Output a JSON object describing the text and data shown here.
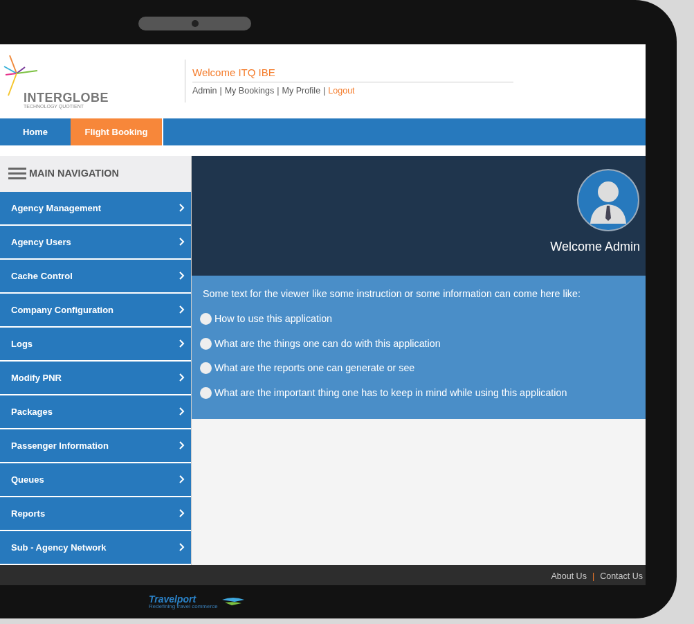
{
  "header": {
    "logo": {
      "name": "INTERGLOBE",
      "tagline": "TECHNOLOGY QUOTIENT"
    },
    "welcome": "Welcome ITQ IBE",
    "separator": "|",
    "user_links": [
      {
        "label": "Admin",
        "kind": "link"
      },
      {
        "label": "My Bookings",
        "kind": "link"
      },
      {
        "label": "My Profile",
        "kind": "link"
      },
      {
        "label": "Logout",
        "kind": "logout"
      }
    ]
  },
  "nav_tabs": [
    {
      "label": "Home",
      "selected": false
    },
    {
      "label": "Flight Booking",
      "selected": true
    }
  ],
  "sidebar": {
    "title": "MAIN NAVIGATION",
    "items": [
      {
        "label": "Agency Management"
      },
      {
        "label": "Agency Users"
      },
      {
        "label": "Cache Control"
      },
      {
        "label": "Company Configuration"
      },
      {
        "label": "Logs"
      },
      {
        "label": "Modify PNR"
      },
      {
        "label": "Packages"
      },
      {
        "label": "Passenger Information"
      },
      {
        "label": "Queues"
      },
      {
        "label": "Reports"
      },
      {
        "label": "Sub - Agency Network"
      }
    ]
  },
  "banner": {
    "greeting": "Welcome Admin"
  },
  "info": {
    "intro": "Some text for the viewer like some instruction or some information can come here like:",
    "items": [
      "How to use this application",
      "What are the things one can do with this application",
      "What are the reports one can generate or see",
      "What are the important thing one has to keep in mind while using this application"
    ]
  },
  "footer": {
    "separator": "|",
    "links": [
      "About Us",
      "Contact Us"
    ]
  },
  "bezel": {
    "brand": "Travelport",
    "tagline": "Redefining travel commerce"
  }
}
